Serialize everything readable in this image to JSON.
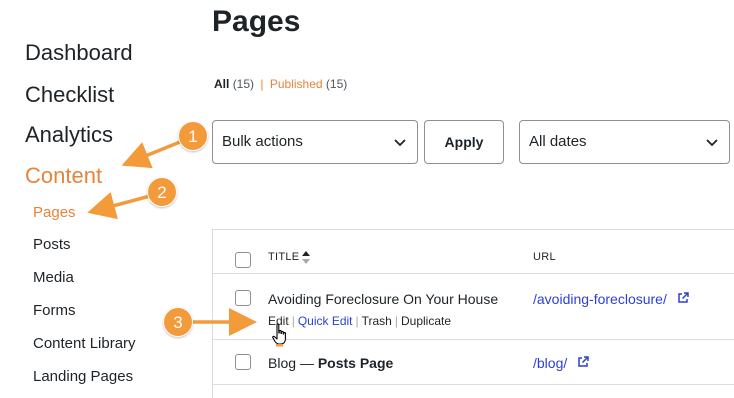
{
  "sidebar": {
    "main_items": [
      {
        "label": "Dashboard"
      },
      {
        "label": "Checklist"
      },
      {
        "label": "Analytics"
      },
      {
        "label": "Content"
      }
    ],
    "sub_items": [
      {
        "label": "Pages"
      },
      {
        "label": "Posts"
      },
      {
        "label": "Media"
      },
      {
        "label": "Forms"
      },
      {
        "label": "Content Library"
      },
      {
        "label": "Landing Pages"
      }
    ],
    "active_main": "Content",
    "active_sub": "Pages"
  },
  "page": {
    "title": "Pages"
  },
  "filters": {
    "all_label": "All",
    "all_count": "(15)",
    "separator": "|",
    "published_label": "Published",
    "published_count": "(15)"
  },
  "toolbar": {
    "bulk_actions": "Bulk actions",
    "apply_label": "Apply",
    "dates": "All dates"
  },
  "table": {
    "columns": {
      "title": "TITLE",
      "url": "URL"
    },
    "rows": [
      {
        "title": "Avoiding Foreclosure On Your House",
        "url": "/avoiding-foreclosure/",
        "actions": {
          "edit": "Edit",
          "quick_edit": "Quick Edit",
          "trash": "Trash",
          "duplicate": "Duplicate",
          "sep": "|"
        }
      },
      {
        "title": "Blog",
        "title_suffix_sep": " — ",
        "title_suffix": "Posts Page",
        "url": "/blog/"
      }
    ]
  },
  "annotations": {
    "step1": "1",
    "step2": "2",
    "step3": "3"
  },
  "colors": {
    "accent": "#e8833a",
    "badge": "#f39a3a",
    "link": "#2c3fd6",
    "text": "#1d2327",
    "border": "#dcdcde"
  }
}
